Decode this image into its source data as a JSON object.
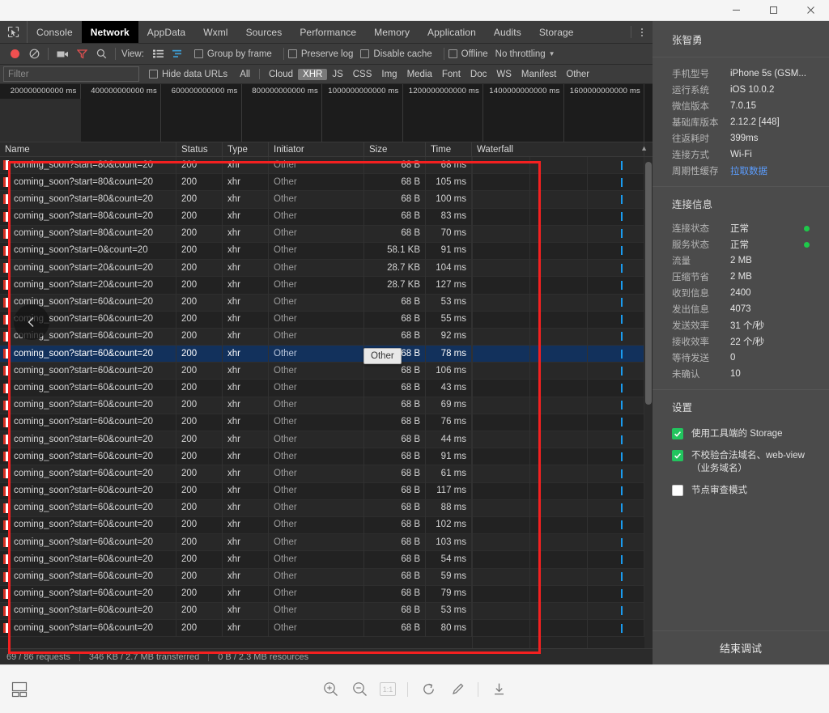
{
  "window": {
    "minimize_label": "minimize",
    "maximize_label": "maximize",
    "close_label": "close"
  },
  "devtools": {
    "tabs": [
      {
        "label": "Console",
        "active": false
      },
      {
        "label": "Network",
        "active": true
      },
      {
        "label": "AppData",
        "active": false
      },
      {
        "label": "Wxml",
        "active": false
      },
      {
        "label": "Sources",
        "active": false
      },
      {
        "label": "Performance",
        "active": false
      },
      {
        "label": "Memory",
        "active": false
      },
      {
        "label": "Application",
        "active": false
      },
      {
        "label": "Audits",
        "active": false
      },
      {
        "label": "Storage",
        "active": false
      }
    ],
    "toolbar": {
      "view_label": "View:",
      "group_by_frame": "Group by frame",
      "preserve_log": "Preserve log",
      "disable_cache": "Disable cache",
      "offline": "Offline",
      "throttling": "No throttling"
    },
    "filterbar": {
      "filter_placeholder": "Filter",
      "filter_value": "",
      "hide_data_urls": "Hide data URLs",
      "types": [
        "All",
        "Cloud",
        "XHR",
        "JS",
        "CSS",
        "Img",
        "Media",
        "Font",
        "Doc",
        "WS",
        "Manifest",
        "Other"
      ],
      "selected_type": "XHR"
    },
    "overview": {
      "ticks": [
        "200000000000 ms",
        "400000000000 ms",
        "600000000000 ms",
        "800000000000 ms",
        "1000000000000 ms",
        "1200000000000 ms",
        "1400000000000 ms",
        "1600000000000 ms"
      ]
    },
    "table": {
      "columns": [
        "Name",
        "Status",
        "Type",
        "Initiator",
        "Size",
        "Time",
        "Waterfall"
      ],
      "sort_indicator": "▲",
      "rows": [
        {
          "name": "coming_soon?start=80&count=20",
          "status": "200",
          "type": "xhr",
          "initiator": "Other",
          "size": "68 B",
          "time": "68 ms",
          "selected": false
        },
        {
          "name": "coming_soon?start=80&count=20",
          "status": "200",
          "type": "xhr",
          "initiator": "Other",
          "size": "68 B",
          "time": "105 ms",
          "selected": false
        },
        {
          "name": "coming_soon?start=80&count=20",
          "status": "200",
          "type": "xhr",
          "initiator": "Other",
          "size": "68 B",
          "time": "100 ms",
          "selected": false
        },
        {
          "name": "coming_soon?start=80&count=20",
          "status": "200",
          "type": "xhr",
          "initiator": "Other",
          "size": "68 B",
          "time": "83 ms",
          "selected": false
        },
        {
          "name": "coming_soon?start=80&count=20",
          "status": "200",
          "type": "xhr",
          "initiator": "Other",
          "size": "68 B",
          "time": "70 ms",
          "selected": false
        },
        {
          "name": "coming_soon?start=0&count=20",
          "status": "200",
          "type": "xhr",
          "initiator": "Other",
          "size": "58.1 KB",
          "time": "91 ms",
          "selected": false
        },
        {
          "name": "coming_soon?start=20&count=20",
          "status": "200",
          "type": "xhr",
          "initiator": "Other",
          "size": "28.7 KB",
          "time": "104 ms",
          "selected": false
        },
        {
          "name": "coming_soon?start=20&count=20",
          "status": "200",
          "type": "xhr",
          "initiator": "Other",
          "size": "28.7 KB",
          "time": "127 ms",
          "selected": false
        },
        {
          "name": "coming_soon?start=60&count=20",
          "status": "200",
          "type": "xhr",
          "initiator": "Other",
          "size": "68 B",
          "time": "53 ms",
          "selected": false
        },
        {
          "name": "coming_soon?start=60&count=20",
          "status": "200",
          "type": "xhr",
          "initiator": "Other",
          "size": "68 B",
          "time": "55 ms",
          "selected": false
        },
        {
          "name": "coming_soon?start=60&count=20",
          "status": "200",
          "type": "xhr",
          "initiator": "Other",
          "size": "68 B",
          "time": "92 ms",
          "selected": false
        },
        {
          "name": "coming_soon?start=60&count=20",
          "status": "200",
          "type": "xhr",
          "initiator": "Other",
          "size": "68 B",
          "time": "78 ms",
          "selected": true
        },
        {
          "name": "coming_soon?start=60&count=20",
          "status": "200",
          "type": "xhr",
          "initiator": "Other",
          "size": "68 B",
          "time": "106 ms",
          "selected": false
        },
        {
          "name": "coming_soon?start=60&count=20",
          "status": "200",
          "type": "xhr",
          "initiator": "Other",
          "size": "68 B",
          "time": "43 ms",
          "selected": false
        },
        {
          "name": "coming_soon?start=60&count=20",
          "status": "200",
          "type": "xhr",
          "initiator": "Other",
          "size": "68 B",
          "time": "69 ms",
          "selected": false
        },
        {
          "name": "coming_soon?start=60&count=20",
          "status": "200",
          "type": "xhr",
          "initiator": "Other",
          "size": "68 B",
          "time": "76 ms",
          "selected": false
        },
        {
          "name": "coming_soon?start=60&count=20",
          "status": "200",
          "type": "xhr",
          "initiator": "Other",
          "size": "68 B",
          "time": "44 ms",
          "selected": false
        },
        {
          "name": "coming_soon?start=60&count=20",
          "status": "200",
          "type": "xhr",
          "initiator": "Other",
          "size": "68 B",
          "time": "91 ms",
          "selected": false
        },
        {
          "name": "coming_soon?start=60&count=20",
          "status": "200",
          "type": "xhr",
          "initiator": "Other",
          "size": "68 B",
          "time": "61 ms",
          "selected": false
        },
        {
          "name": "coming_soon?start=60&count=20",
          "status": "200",
          "type": "xhr",
          "initiator": "Other",
          "size": "68 B",
          "time": "117 ms",
          "selected": false
        },
        {
          "name": "coming_soon?start=60&count=20",
          "status": "200",
          "type": "xhr",
          "initiator": "Other",
          "size": "68 B",
          "time": "88 ms",
          "selected": false
        },
        {
          "name": "coming_soon?start=60&count=20",
          "status": "200",
          "type": "xhr",
          "initiator": "Other",
          "size": "68 B",
          "time": "102 ms",
          "selected": false
        },
        {
          "name": "coming_soon?start=60&count=20",
          "status": "200",
          "type": "xhr",
          "initiator": "Other",
          "size": "68 B",
          "time": "103 ms",
          "selected": false
        },
        {
          "name": "coming_soon?start=60&count=20",
          "status": "200",
          "type": "xhr",
          "initiator": "Other",
          "size": "68 B",
          "time": "54 ms",
          "selected": false
        },
        {
          "name": "coming_soon?start=60&count=20",
          "status": "200",
          "type": "xhr",
          "initiator": "Other",
          "size": "68 B",
          "time": "59 ms",
          "selected": false
        },
        {
          "name": "coming_soon?start=60&count=20",
          "status": "200",
          "type": "xhr",
          "initiator": "Other",
          "size": "68 B",
          "time": "79 ms",
          "selected": false
        },
        {
          "name": "coming_soon?start=60&count=20",
          "status": "200",
          "type": "xhr",
          "initiator": "Other",
          "size": "68 B",
          "time": "53 ms",
          "selected": false
        },
        {
          "name": "coming_soon?start=60&count=20",
          "status": "200",
          "type": "xhr",
          "initiator": "Other",
          "size": "68 B",
          "time": "80 ms",
          "selected": false
        }
      ]
    },
    "tooltip": {
      "text": "Other"
    },
    "statusbar": {
      "requests": "69 / 86 requests",
      "transferred": "346 KB / 2.7 MB transferred",
      "resources": "0 B / 2.3 MB resources"
    }
  },
  "device_panel": {
    "title": "张智勇",
    "info": [
      {
        "key": "手机型号",
        "value": "iPhone 5s (GSM...",
        "link": false
      },
      {
        "key": "运行系统",
        "value": "iOS 10.0.2",
        "link": false
      },
      {
        "key": "微信版本",
        "value": "7.0.15",
        "link": false
      },
      {
        "key": "基础库版本",
        "value": "2.12.2 [448]",
        "link": false
      },
      {
        "key": "往返耗时",
        "value": "399ms",
        "link": false
      },
      {
        "key": "连接方式",
        "value": "Wi-Fi",
        "link": false
      },
      {
        "key": "周期性缓存",
        "value": "拉取数据",
        "link": true
      }
    ],
    "connection_heading": "连接信息",
    "connection": [
      {
        "key": "连接状态",
        "value": "正常",
        "dot": true
      },
      {
        "key": "服务状态",
        "value": "正常",
        "dot": true
      },
      {
        "key": "流量",
        "value": "2 MB",
        "dot": false
      },
      {
        "key": "压缩节省",
        "value": "2 MB",
        "dot": false
      },
      {
        "key": "收到信息",
        "value": "2400",
        "dot": false
      },
      {
        "key": "发出信息",
        "value": "4073",
        "dot": false
      },
      {
        "key": "发送效率",
        "value": "31 个/秒",
        "dot": false
      },
      {
        "key": "接收效率",
        "value": "22 个/秒",
        "dot": false
      },
      {
        "key": "等待发送",
        "value": "0",
        "dot": false
      },
      {
        "key": "未确认",
        "value": "10",
        "dot": false
      }
    ],
    "settings_heading": "设置",
    "settings": [
      {
        "label": "使用工具端的 Storage",
        "checked": true
      },
      {
        "label": "不校验合法域名、web-view（业务域名）",
        "checked": true
      },
      {
        "label": "节点审查模式",
        "checked": false
      }
    ],
    "footer_button": "结束调试"
  },
  "bottom_toolbar": {
    "icons": [
      "layout-icon",
      "zoom-in-icon",
      "zoom-out-icon",
      "zoom-reset-icon",
      "refresh-icon",
      "pencil-icon",
      "download-icon"
    ],
    "zoom_reset_label": "1:1"
  },
  "colors": {
    "accent_red": "#f42020",
    "selection_blue": "#12315c",
    "status_green": "#1ec94a",
    "waterfall_blue": "#1a9cf0",
    "link_blue": "#5b9dff"
  }
}
